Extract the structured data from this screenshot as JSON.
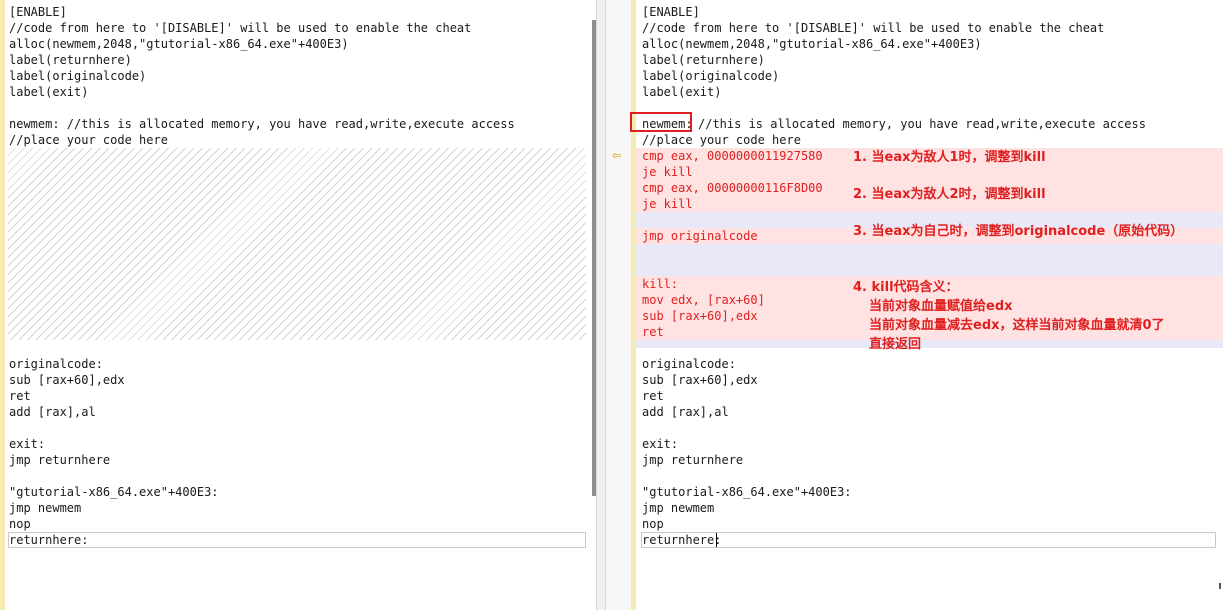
{
  "left_editor": {
    "lines": [
      "[ENABLE]",
      "//code from here to '[DISABLE]' will be used to enable the cheat",
      "alloc(newmem,2048,\"gtutorial-x86_64.exe\"+400E3)",
      "label(returnhere)",
      "label(originalcode)",
      "label(exit)",
      "",
      "newmem: //this is allocated memory, you have read,write,execute access",
      "//place your code here"
    ],
    "lines_bottom": [
      "originalcode:",
      "sub [rax+60],edx",
      "ret",
      "add [rax],al",
      "",
      "exit:",
      "jmp returnhere",
      "",
      "\"gtutorial-x86_64.exe\"+400E3:",
      "jmp newmem",
      "nop",
      "returnhere:"
    ]
  },
  "right_editor": {
    "header_lines": [
      "[ENABLE]",
      "//code from here to '[DISABLE]' will be used to enable the cheat",
      "alloc(newmem,2048,\"gtutorial-x86_64.exe\"+400E3)",
      "label(returnhere)",
      "label(originalcode)",
      "label(exit)"
    ],
    "newmem_label": "newmem:",
    "newmem_comment": "//this is allocated memory, you have read,write,execute access",
    "place_comment": "//place your code here",
    "inserted_lines": [
      "cmp eax, 0000000011927580",
      "je kill",
      "cmp eax, 00000000116F8D00",
      "je kill",
      "jmp originalcode",
      "kill:",
      "mov edx, [rax+60]",
      "sub [rax+60],edx",
      "ret"
    ],
    "footer_lines": [
      "originalcode:",
      "sub [rax+60],edx",
      "ret",
      "add [rax],al",
      "",
      "exit:",
      "jmp returnhere",
      "",
      "\"gtutorial-x86_64.exe\"+400E3:",
      "jmp newmem",
      "nop",
      "returnhere:"
    ],
    "gutter_marker": "⇦"
  },
  "annotations": {
    "note1": "1. 当eax为敌人1时，调整到kill",
    "note2": "2. 当eax为敌人2时，调整到kill",
    "note3": "3. 当eax为自己时，调整到originalcode（原始代码）",
    "note4_title": "4. kill代码含义：",
    "note4_line1": "当前对象血量赋值给edx",
    "note4_line2": "当前对象血量减去edx，这样当前对象血量就清0了",
    "note4_line3": "直接返回"
  },
  "colors": {
    "annotation_red": "#e02020",
    "highlight_pink": "#ffe2e2",
    "highlight_lavender": "#e8e8f8",
    "gutter_yellow": "#f7ecb0"
  }
}
